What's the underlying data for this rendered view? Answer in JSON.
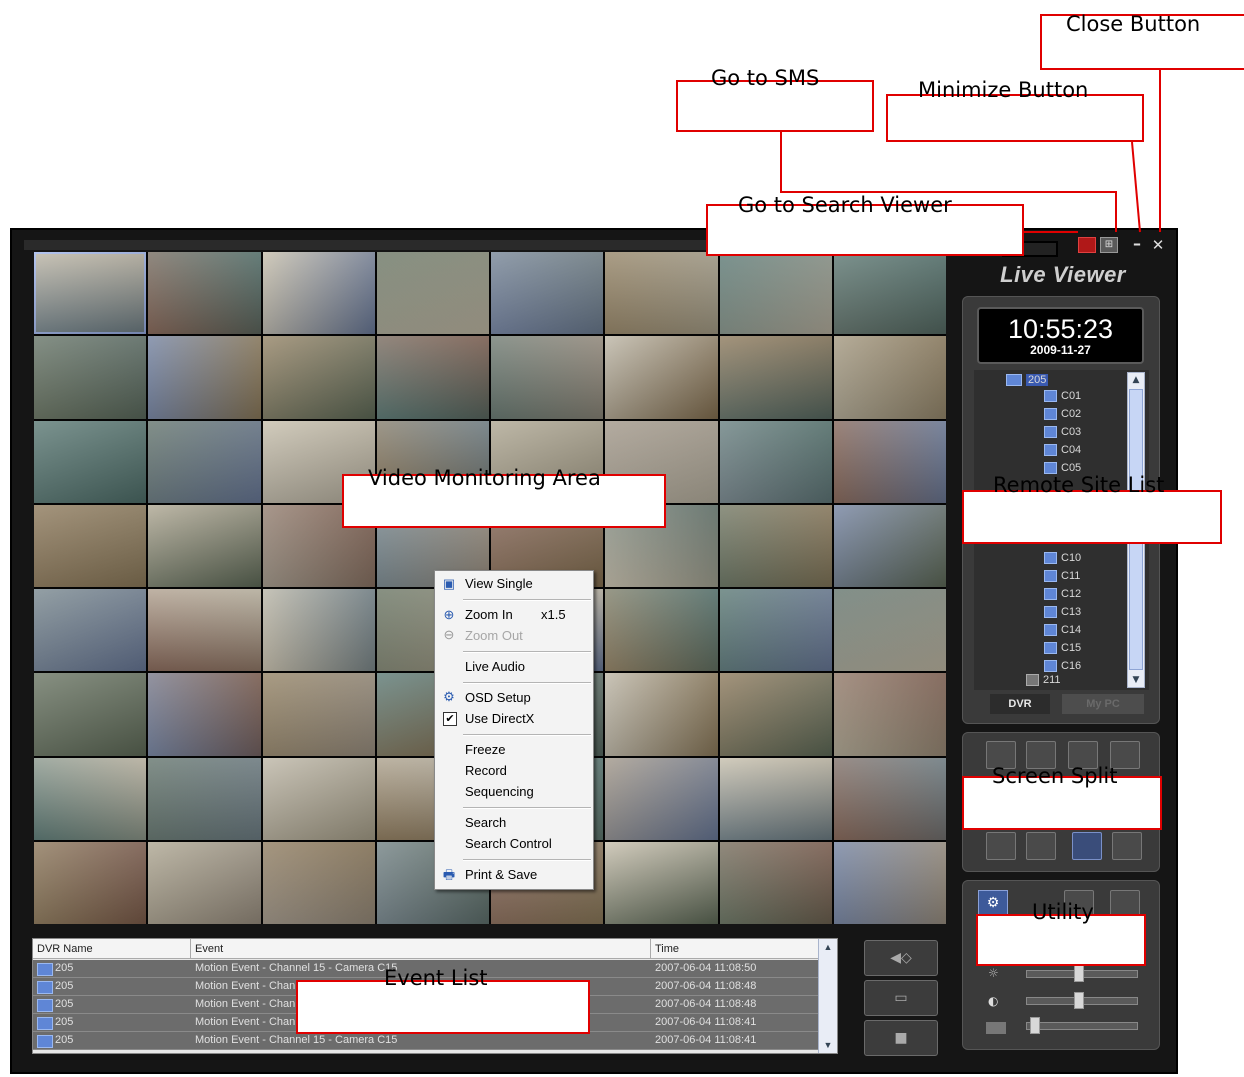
{
  "app": {
    "title": "Live Viewer",
    "time": "10:55:23",
    "date": "2009-11-27"
  },
  "annotations": {
    "close": "Close Button",
    "sms": "Go to SMS",
    "minimize": "Minimize Button",
    "search_viewer": "Go to Search Viewer",
    "video_area": "Video Monitoring Area",
    "remote_site": "Remote Site List",
    "screen_split": "Screen Split",
    "utility": "Utility",
    "event_list": "Event List"
  },
  "context_menu": {
    "view_single": "View Single",
    "zoom_in": "Zoom In",
    "zoom_factor": "x1.5",
    "zoom_out": "Zoom Out",
    "live_audio": "Live Audio",
    "osd_setup": "OSD Setup",
    "use_directx": "Use DirectX",
    "freeze": "Freeze",
    "record": "Record",
    "sequencing": "Sequencing",
    "search": "Search",
    "search_control": "Search Control",
    "print_save": "Print & Save"
  },
  "tree": {
    "root": "205",
    "channels_top": [
      "C01",
      "C02",
      "C03",
      "C04",
      "C05"
    ],
    "channels_bottom": [
      "C10",
      "C11",
      "C12",
      "C13",
      "C14",
      "C15",
      "C16"
    ],
    "next_site": "211"
  },
  "tabs": {
    "dvr": "DVR",
    "mypc": "My PC"
  },
  "event_table": {
    "headers": [
      "DVR Name",
      "Event",
      "Time"
    ],
    "rows": [
      {
        "dvr": "205",
        "event": "Motion Event  -  Channel 15  -  Camera C15",
        "time": "2007-06-04 11:08:50"
      },
      {
        "dvr": "205",
        "event": "Motion Event  -  Channel 15  -  Camera C15",
        "time": "2007-06-04 11:08:48"
      },
      {
        "dvr": "205",
        "event": "Motion Event  -  Channel 15  -  Camera C15",
        "time": "2007-06-04 11:08:48"
      },
      {
        "dvr": "205",
        "event": "Motion Event  -  Channel 15  -  Camera C15",
        "time": "2007-06-04 11:08:41"
      },
      {
        "dvr": "205",
        "event": "Motion Event  -  Channel 15  -  Camera C15",
        "time": "2007-06-04 11:08:41"
      }
    ]
  },
  "tile_palette": [
    "#6f7f86",
    "#8c7a5a",
    "#a8a08a",
    "#5f6b58",
    "#b8b1a0",
    "#7c5a4a",
    "#4f6f6a",
    "#9a8f80",
    "#6a7a9a",
    "#857050",
    "#c2baa6",
    "#586a62"
  ]
}
